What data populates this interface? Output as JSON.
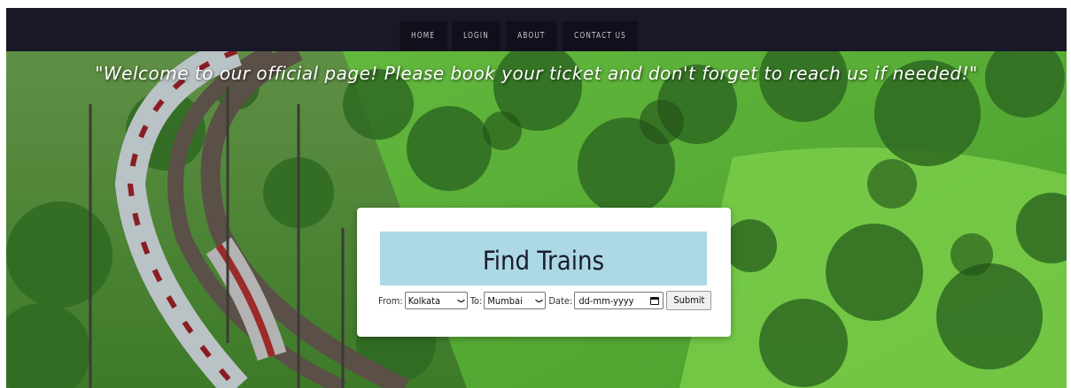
{
  "nav": {
    "items": [
      "HOME",
      "LOGIN",
      "ABOUT",
      "CONTACT US"
    ]
  },
  "hero": {
    "welcome": "\"Welcome to our official page! Please book your ticket and don't forget to reach us if needed!\""
  },
  "finder": {
    "title": "Find Trains",
    "from_label": "From:",
    "from_value": "Kolkata",
    "to_label": "To:",
    "to_value": "Mumbai",
    "date_label": "Date:",
    "date_placeholder": "dd-mm-yyyy",
    "submit_label": "Submit"
  },
  "colors": {
    "nav_bg": "#181828",
    "title_bg": "#add8e6",
    "foliage": "#5fae3a"
  }
}
